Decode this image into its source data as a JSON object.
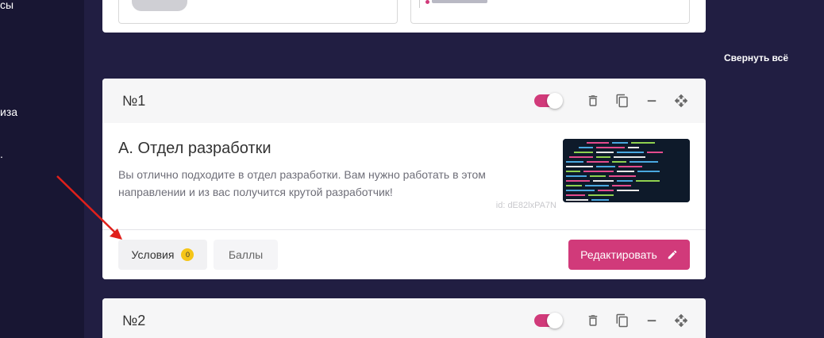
{
  "sidebar": {
    "items": [
      {
        "label": "сы"
      },
      {
        "label": "иза"
      },
      {
        "label": "."
      }
    ]
  },
  "toolbar": {
    "collapse_all_label": "Свернуть всё"
  },
  "cards": [
    {
      "number": "№1",
      "result_title": "А. Отдел разработки",
      "result_description": "Вы отлично подходите в отдел разработки. Вам нужно работать в этом направлении и из вас получится крутой разработчик!",
      "result_id": "id: dE82lxPA7N",
      "tabs": [
        {
          "label": "Условия",
          "badge": "0"
        },
        {
          "label": "Баллы"
        }
      ],
      "edit_label": "Редактировать",
      "enabled": true
    },
    {
      "number": "№2",
      "enabled": true
    }
  ],
  "icons": {
    "toggle": "toggle-switch-icon",
    "delete": "trash-icon",
    "copy": "copy-icon",
    "collapse": "minus-icon",
    "move": "move-arrows-icon",
    "edit": "pencil-icon"
  },
  "colors": {
    "background": "#211e42",
    "sidebar": "#181633",
    "accent": "#d13a7a",
    "badge": "#f5c518",
    "card": "#ffffff",
    "card_header": "#f6f6f7"
  }
}
